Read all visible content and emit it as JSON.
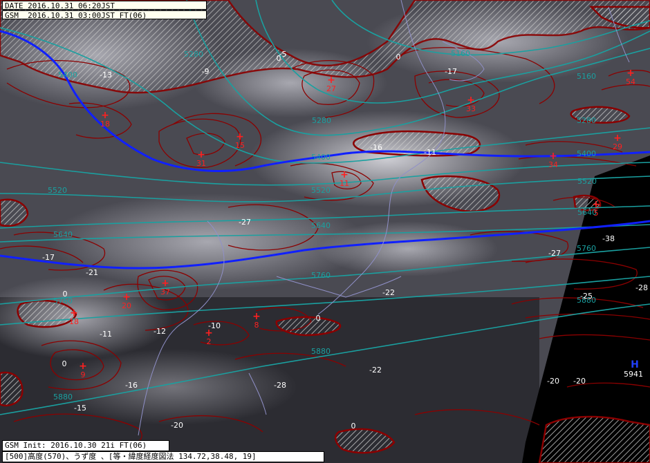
{
  "header": {
    "date_line": "DATE 2016.10.31 06:20JST",
    "model_line": "GSM  2016.10.31 03:00JST FT(06)"
  },
  "footer": {
    "init_line": "GSM Init: 2016.10.30 21i FT(06)",
    "caption_line": "[500]高度(570)、うず度 、[等・緯度経度図法 134.72,38.48, 19]"
  },
  "colors": {
    "height_contour": "#1aa0a0",
    "height_highlight": "#1020ff",
    "vorticity": "#8b0000",
    "positive_mark": "#ff2020",
    "negative_mark": "#ffffff",
    "background_ir": "#3a3a40",
    "no_data": "#000000"
  },
  "height_labels": [
    "5280",
    "5160",
    "5160",
    "5280",
    "5400",
    "5280",
    "5400",
    "5520",
    "5520",
    "5640",
    "5640",
    "5640",
    "5760",
    "5760",
    "5760",
    "5880",
    "5880",
    "5880",
    "5400",
    "5520"
  ],
  "vorticity_values": {
    "positive": [
      "54",
      "27",
      "33",
      "18",
      "15",
      "31",
      "11",
      "34",
      "5",
      "37",
      "20",
      "18",
      "8",
      "2",
      "9",
      "29"
    ],
    "negative": [
      "-5",
      "-9",
      "-13",
      "-17",
      "-16",
      "-11",
      "-27",
      "-17",
      "-21",
      "-22",
      "-27",
      "-38",
      "-28",
      "-25",
      "-20",
      "-11",
      "-12",
      "-10",
      "-16",
      "-28",
      "-22",
      "-15",
      "-20",
      "-20"
    ],
    "zero": [
      "0",
      "0",
      "0",
      "0",
      "0",
      "0"
    ]
  },
  "high_marker": {
    "symbol": "H",
    "value": "5941"
  }
}
